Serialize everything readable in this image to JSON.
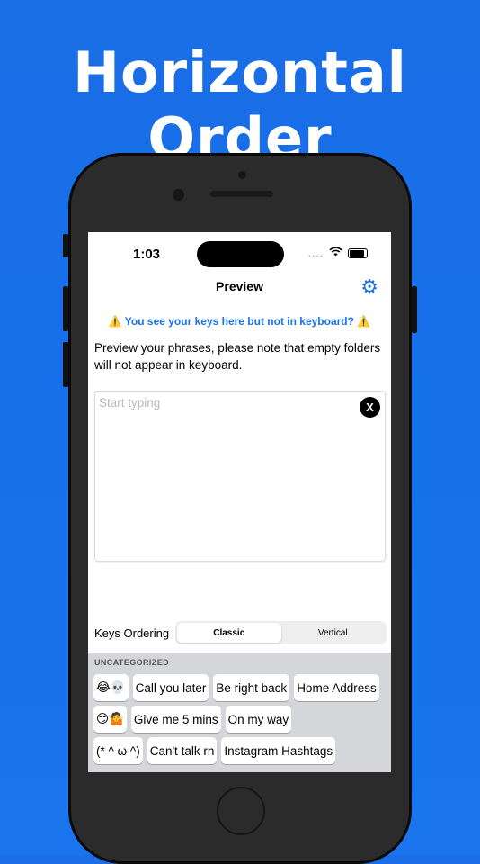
{
  "headline": "Horizontal Order",
  "status": {
    "time": "1:03",
    "signal": "....",
    "wifi": "wifi-icon"
  },
  "nav": {
    "title": "Preview",
    "settings_icon": "gear-icon"
  },
  "warning": "⚠️ You see your keys here but not in keyboard? ⚠️",
  "description": "Preview your phrases, please note that empty folders will not appear in keyboard.",
  "input": {
    "placeholder": "Start typing",
    "value": "",
    "clear_label": "X"
  },
  "ordering": {
    "label": "Keys Ordering",
    "options": [
      "Classic",
      "Vertical"
    ],
    "selected": "Classic"
  },
  "keyboard": {
    "section": "UNCATEGORIZED",
    "rows": [
      [
        "😂💀",
        "Call you later",
        "Be right back",
        "Home Address"
      ],
      [
        "😏🤷",
        "Give me 5 mins",
        "On my way"
      ],
      [
        "(* ^ ω ^)",
        "Can't talk rn",
        "Instagram Hashtags"
      ]
    ]
  },
  "colors": {
    "background": "#1670ea",
    "accent": "#1a73e8",
    "phone_body": "#2b2b2b"
  }
}
